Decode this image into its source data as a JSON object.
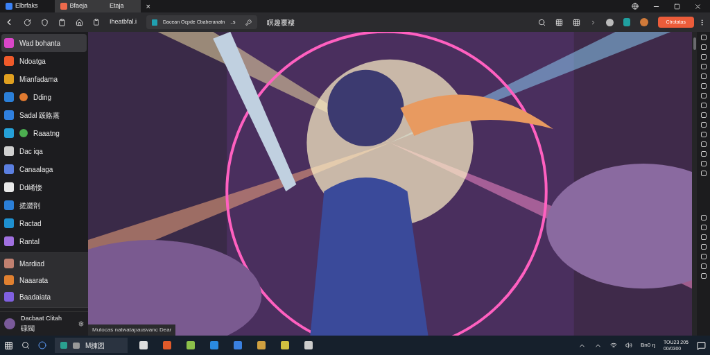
{
  "tabs": [
    {
      "label": "Elbrfaks",
      "selected": false,
      "color": "#3b82f6"
    },
    {
      "label": "Bfaeja",
      "selected": true,
      "color": "#ef6a4c"
    },
    {
      "label": "Etaja",
      "selected": true
    }
  ],
  "tab_close": "×",
  "toolbar": {
    "bookmark_label": "Iheatbfal.i",
    "address": "Dacean Ocpde Cbaberanatn",
    "address_suffix": "..s",
    "side_text": "瞑趣覆褸",
    "action_button": "Ctrotatas"
  },
  "sidebar": {
    "sections": [
      {
        "shaded": false,
        "items": [
          {
            "label": "Wad bohanta",
            "selected": true,
            "color": "#d946c8"
          },
          {
            "label": "Ndoatga",
            "selected": false,
            "color": "#ef5a2a"
          },
          {
            "label": "Mianfadama",
            "selected": false,
            "color": "#e0a020"
          },
          {
            "label": "Dding",
            "selected": false,
            "color": "#2b7fd8",
            "badge": {
              "color": "#e07a30"
            }
          },
          {
            "label": "Sadal 䟦賂蒸",
            "selected": false,
            "color": "#2f80e0"
          },
          {
            "label": "Raaatng",
            "selected": false,
            "color": "#25a0d8",
            "badge": {
              "color": "#4caf50"
            }
          },
          {
            "label": "Dac iqa",
            "selected": false,
            "color": "#d0d0d0"
          },
          {
            "label": "Canaalaga",
            "selected": false,
            "color": "#5b7fe0"
          },
          {
            "label": "Dd崤㥪",
            "selected": false,
            "color": "#e8e8e8"
          },
          {
            "label": "搓澀剖",
            "selected": false,
            "color": "#2b7fd8"
          },
          {
            "label": "Ractad",
            "selected": false,
            "color": "#1e90d0"
          },
          {
            "label": "Rantal",
            "selected": false,
            "color": "#a070e0"
          }
        ]
      },
      {
        "shaded": true,
        "items": [
          {
            "label": "Mardiad",
            "selected": false,
            "color": "#c08070"
          },
          {
            "label": "Naaarata",
            "selected": false,
            "color": "#e08030"
          },
          {
            "label": "Baadaiata",
            "selected": false,
            "color": "#8060e0"
          }
        ]
      }
    ],
    "profile": {
      "name": "Dacbaat Clitah",
      "sub": "碌閥"
    }
  },
  "status_tooltip": "Mutocas natwatapausvanc Dear",
  "taskbar": {
    "search_app": "M㨂図",
    "tray_text": "Bn0 ŋ",
    "clock": [
      "TOU23 205",
      "00/0300"
    ]
  }
}
